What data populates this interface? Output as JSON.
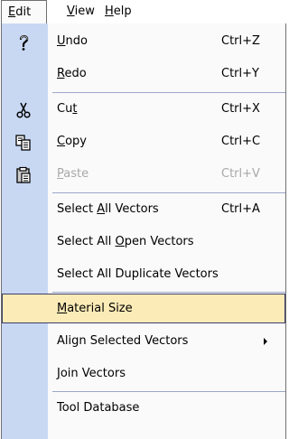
{
  "menubar": {
    "edit": {
      "pre": "",
      "ul": "E",
      "post": "dit"
    },
    "view": {
      "pre": "",
      "ul": "V",
      "post": "iew"
    },
    "help": {
      "pre": "",
      "ul": "H",
      "post": "elp"
    }
  },
  "menu": {
    "undo": {
      "pre": "",
      "ul": "U",
      "post": "ndo",
      "shortcut": "Ctrl+Z",
      "icon": "undo-icon"
    },
    "redo": {
      "pre": "",
      "ul": "R",
      "post": "edo",
      "shortcut": "Ctrl+Y"
    },
    "cut": {
      "pre": "Cu",
      "ul": "t",
      "post": "",
      "shortcut": "Ctrl+X",
      "icon": "scissors-icon"
    },
    "copy": {
      "pre": "",
      "ul": "C",
      "post": "opy",
      "shortcut": "Ctrl+C",
      "icon": "copy-icon"
    },
    "paste": {
      "pre": "",
      "ul": "P",
      "post": "aste",
      "shortcut": "Ctrl+V",
      "icon": "clipboard-icon",
      "disabled": true
    },
    "select_all": {
      "pre": "Select ",
      "ul": "A",
      "post": "ll Vectors",
      "shortcut": "Ctrl+A"
    },
    "select_open": {
      "pre": "Select All ",
      "ul": "O",
      "post": "pen Vectors"
    },
    "select_dup": {
      "pre": "Select All Duplicate Vectors",
      "ul": "",
      "post": ""
    },
    "material_size": {
      "pre": "",
      "ul": "M",
      "post": "aterial Size",
      "highlighted": true
    },
    "align": {
      "pre": "Align Selected Vectors",
      "ul": "",
      "post": "",
      "submenu": true
    },
    "join": {
      "pre": "",
      "ul": "J",
      "post": "oin Vectors"
    },
    "tool_db": {
      "pre": "Tool Database",
      "ul": "",
      "post": ""
    }
  },
  "colors": {
    "gutter": "#c8d8f3",
    "menu_bg": "#fbfafa",
    "highlight": "#fbebb7",
    "highlight_border": "#3d3d6c",
    "disabled_text": "#a8a8a8"
  }
}
